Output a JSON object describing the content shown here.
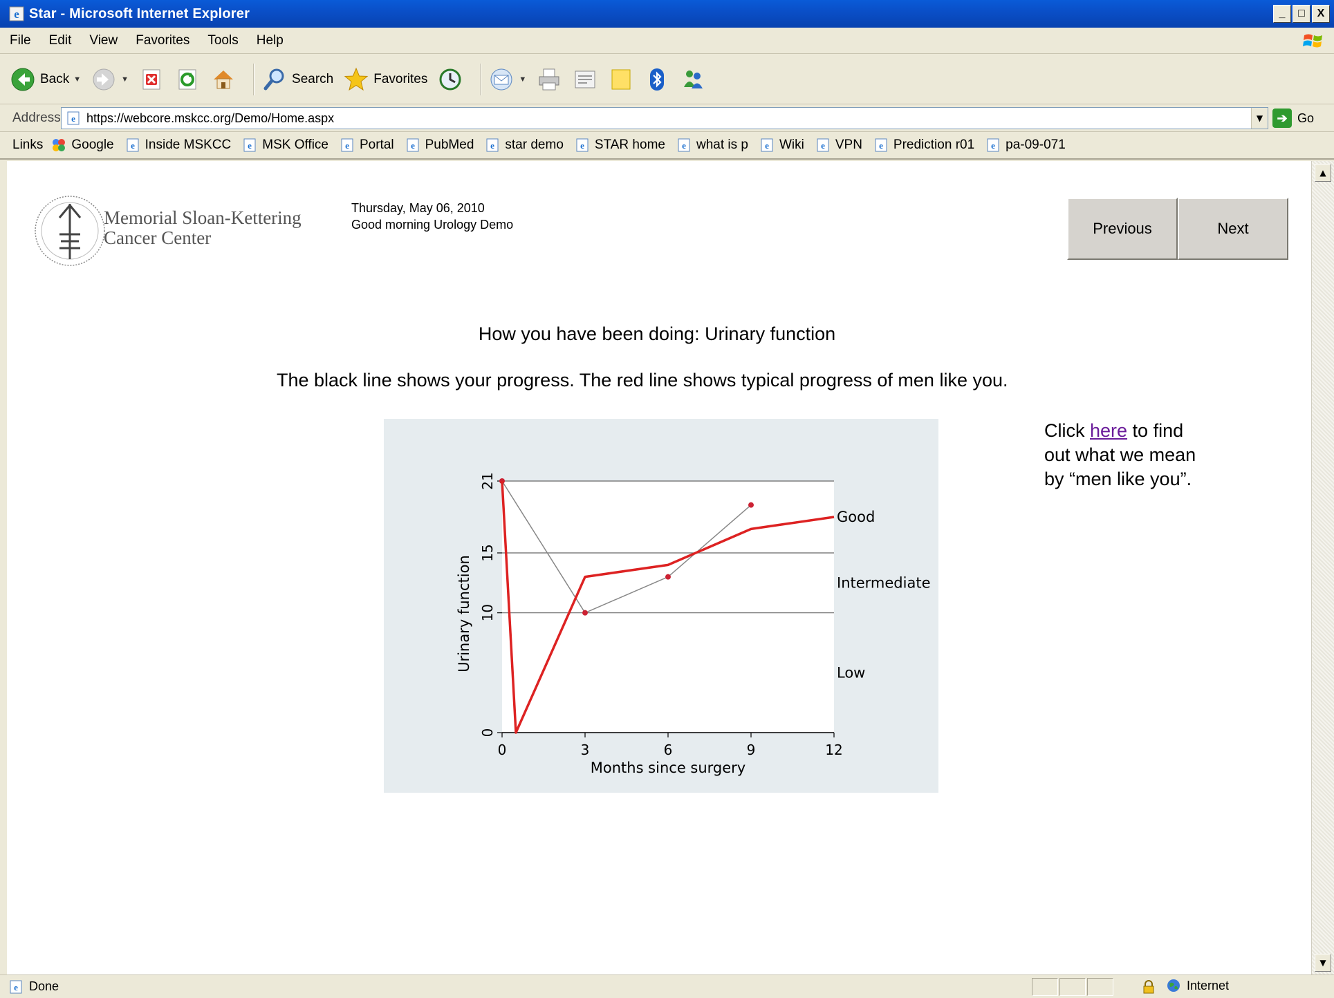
{
  "window": {
    "title": "Star - Microsoft Internet Explorer",
    "controls": {
      "minimize": "_",
      "maximize": "□",
      "close": "X"
    }
  },
  "menu": [
    "File",
    "Edit",
    "View",
    "Favorites",
    "Tools",
    "Help"
  ],
  "toolbar": {
    "back_label": "Back",
    "search_label": "Search",
    "favorites_label": "Favorites"
  },
  "address": {
    "label": "Address",
    "url": "https://webcore.mskcc.org/Demo/Home.aspx",
    "go_label": "Go"
  },
  "links": {
    "label": "Links",
    "items": [
      "Google",
      "Inside MSKCC",
      "MSK Office",
      "Portal",
      "PubMed",
      "star demo",
      "STAR home",
      "what is p",
      "Wiki",
      "VPN",
      "Prediction r01",
      "pa-09-071"
    ]
  },
  "page": {
    "org_name_line1": "Memorial Sloan-Kettering",
    "org_name_line2": "Cancer Center",
    "date": "Thursday, May 06, 2010",
    "greeting": "Good morning Urology Demo",
    "previous_label": "Previous",
    "next_label": "Next",
    "heading": "How you have been doing: Urinary function",
    "subheading": "The black line shows your progress. The red line shows typical progress of men like you.",
    "note_before": "Click ",
    "note_link": "here",
    "note_after": " to find out what we mean by “men like you”."
  },
  "chart_data": {
    "type": "line",
    "xlabel": "Months since surgery",
    "ylabel": "Urinary function",
    "xlim": [
      0,
      12
    ],
    "ylim": [
      0,
      21
    ],
    "xticks": [
      0,
      3,
      6,
      9,
      12
    ],
    "yticks": [
      0,
      10,
      15,
      21
    ],
    "reference_lines_y": [
      10,
      15,
      21
    ],
    "band_labels": [
      {
        "label": "Good",
        "y": 18
      },
      {
        "label": "Intermediate",
        "y": 12.5
      },
      {
        "label": "Low",
        "y": 5
      }
    ],
    "series": [
      {
        "color": "#888888",
        "markers": "#cc2233",
        "x": [
          0,
          3,
          6,
          9
        ],
        "y": [
          21,
          10,
          13,
          19
        ]
      },
      {
        "color": "#dd2222",
        "x": [
          0,
          0.5,
          3,
          6,
          9,
          12
        ],
        "y": [
          21,
          0,
          13,
          14,
          17,
          18
        ]
      }
    ],
    "grid": false,
    "legend": "none"
  },
  "status": {
    "text": "Done",
    "zone": "Internet"
  }
}
